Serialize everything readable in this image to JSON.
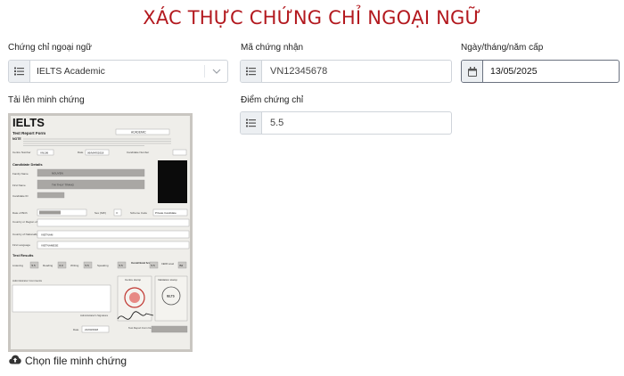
{
  "page_title": "XÁC THỰC CHỨNG CHỈ NGOẠI NGỮ",
  "certificate": {
    "label": "Chứng chỉ ngoại ngữ",
    "value": "IELTS Academic",
    "icon": "list-icon"
  },
  "certificate_number": {
    "label": "Mã chứng nhận",
    "value": "VN12345678",
    "icon": "list-icon"
  },
  "issue_date": {
    "label": "Ngày/tháng/năm cấp",
    "value": "13/05/2025",
    "icon": "calendar-icon"
  },
  "score": {
    "label": "Điểm chứng chỉ",
    "value": "5.5",
    "icon": "list-icon"
  },
  "evidence": {
    "label": "Tải lên minh chứng",
    "upload_label": "Chọn file minh chứng",
    "upload_icon": "cloud-upload-icon",
    "document": {
      "logo": "IELTS",
      "heading": "Test Report Form",
      "note_label": "NOTE",
      "type": "ACADEMIC",
      "centre_label": "Centre Number",
      "centre_value": "VN106",
      "date_label": "Date",
      "date_value": "06/MAR/2018",
      "candidate_no_label": "Candidate Number",
      "section_candidate": "Candidate Details",
      "family_label": "Family Name",
      "family_value": "NGUYEN",
      "first_label": "First Name",
      "first_value": "THI THUY TRANG",
      "cid_label": "Candidate ID",
      "dob_label": "Date of Birth",
      "sex_label": "Sex (M/F)",
      "sex_value": "F",
      "scheme_label": "Scheme Code",
      "scheme_value": "Private Candidate",
      "country_label": "Country or Region of Origin",
      "nationality_label": "Country of Nationality",
      "nationality_value": "VIETNAM",
      "language_label": "First Language",
      "language_value": "VIETNAMESE",
      "results_label": "Test Results",
      "listening_label": "Listening",
      "listening_value": "5.5",
      "reading_label": "Reading",
      "reading_value": "6.0",
      "writing_label": "Writing",
      "writing_value": "5.5",
      "speaking_label": "Speaking",
      "speaking_value": "5.5",
      "overall_label": "Overall Band Score",
      "overall_value": "5.5",
      "cefr_label": "CEFR Level",
      "cefr_value": "B2",
      "admin_label": "Administrator Comments",
      "centre_stamp_label": "Centre stamp",
      "validation_label": "Validation stamp",
      "signature_label": "Administrator's Signature",
      "bottom_date_label": "Date",
      "bottom_date_value": "21/03/2018",
      "trf_label": "Test Report Form Number"
    }
  },
  "colors": {
    "title": "#b3191f",
    "addon_bg": "#eceff2",
    "border": "#cfd4da"
  }
}
